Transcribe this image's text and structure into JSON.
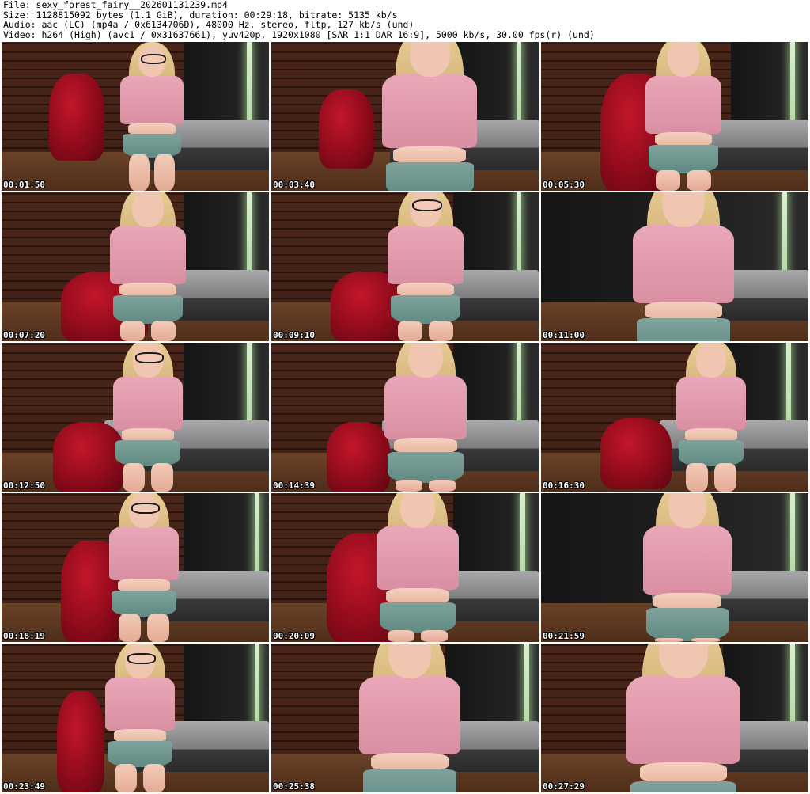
{
  "header": {
    "file_line": "File: sexy_forest_fairy__202601131239.mp4",
    "size_line": "Size: 1128815092 bytes (1.1 GiB), duration: 00:29:18, bitrate: 5135 kb/s",
    "audio_line": "Audio: aac (LC) (mp4a / 0x6134706D), 48000 Hz, stereo, fltp, 127 kb/s (und)",
    "video_line": "Video: h264 (High) (avc1 / 0x31637661), yuv420p, 1920x1080 [SAR 1:1 DAR 16:9], 5000 kb/s, 30.00 fps(r) (und)"
  },
  "thumbnails": [
    {
      "timestamp": "00:01:50"
    },
    {
      "timestamp": "00:03:40"
    },
    {
      "timestamp": "00:05:30"
    },
    {
      "timestamp": "00:07:20"
    },
    {
      "timestamp": "00:09:10"
    },
    {
      "timestamp": "00:11:00"
    },
    {
      "timestamp": "00:12:50"
    },
    {
      "timestamp": "00:14:39"
    },
    {
      "timestamp": "00:16:30"
    },
    {
      "timestamp": "00:18:19"
    },
    {
      "timestamp": "00:20:09"
    },
    {
      "timestamp": "00:21:59"
    },
    {
      "timestamp": "00:23:49"
    },
    {
      "timestamp": "00:25:38"
    },
    {
      "timestamp": "00:27:29"
    }
  ],
  "colors": {
    "background": "#ffffff",
    "header_text": "#000000",
    "timestamp_text": "#ffffff",
    "timestamp_outline": "#000000"
  }
}
